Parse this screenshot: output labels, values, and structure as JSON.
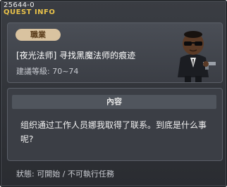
{
  "window": {
    "quest_id": "25644-0",
    "title": "QUEST INFO"
  },
  "header": {
    "job_label": "職業",
    "quest_name": "[夜光法师] 寻找黑魔法师的痕迹",
    "level_text": "建議等級: 70~74"
  },
  "content": {
    "heading": "內容",
    "body": "组织通过工作人员娜我取得了联系。到底是什么事呢?"
  },
  "footer": {
    "status_text": "狀態: 可開始 / 不可執行任務"
  },
  "colors": {
    "title_gold": "#e9c24a",
    "badge_bg": "#d9c3a0",
    "window_bg": "#2f3237"
  }
}
